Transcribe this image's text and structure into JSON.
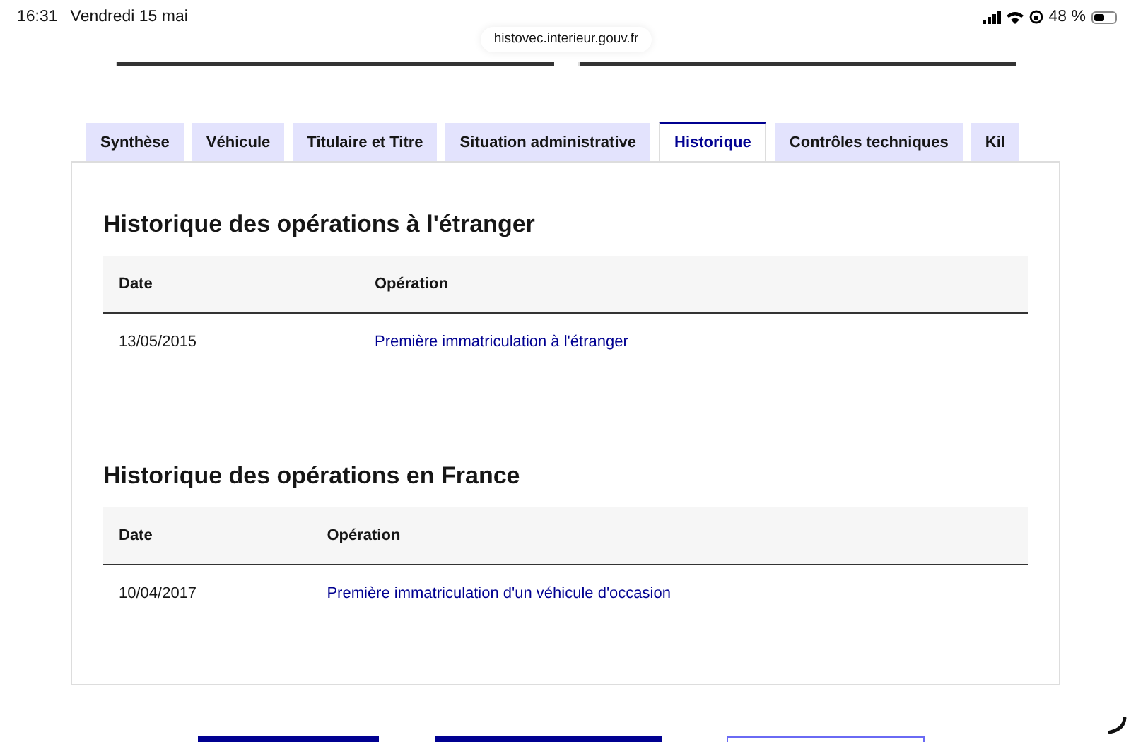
{
  "status_bar": {
    "time": "16:31",
    "date": "Vendredi 15 mai",
    "battery": "48 %"
  },
  "address_bar": {
    "url": "histovec.interieur.gouv.fr"
  },
  "tabs": [
    {
      "label": "Synthèse",
      "selected": false
    },
    {
      "label": "Véhicule",
      "selected": false
    },
    {
      "label": "Titulaire et Titre",
      "selected": false
    },
    {
      "label": "Situation administrative",
      "selected": false
    },
    {
      "label": "Historique",
      "selected": true
    },
    {
      "label": "Contrôles techniques",
      "selected": false
    },
    {
      "label": "Kil",
      "selected": false
    }
  ],
  "sections": [
    {
      "title": "Historique des opérations à l'étranger",
      "table": {
        "columns": [
          "Date",
          "Opération"
        ],
        "rows": [
          [
            "13/05/2015",
            "Première immatriculation à l'étranger"
          ]
        ]
      }
    },
    {
      "title": "Historique des opérations en France",
      "table": {
        "columns": [
          "Date",
          "Opération"
        ],
        "rows": [
          [
            "10/04/2017",
            "Première immatriculation d'un véhicule d'occasion"
          ]
        ]
      }
    }
  ],
  "bottom_buttons": [
    {
      "kind": "filled"
    },
    {
      "kind": "filled"
    },
    {
      "kind": "outline"
    }
  ]
}
